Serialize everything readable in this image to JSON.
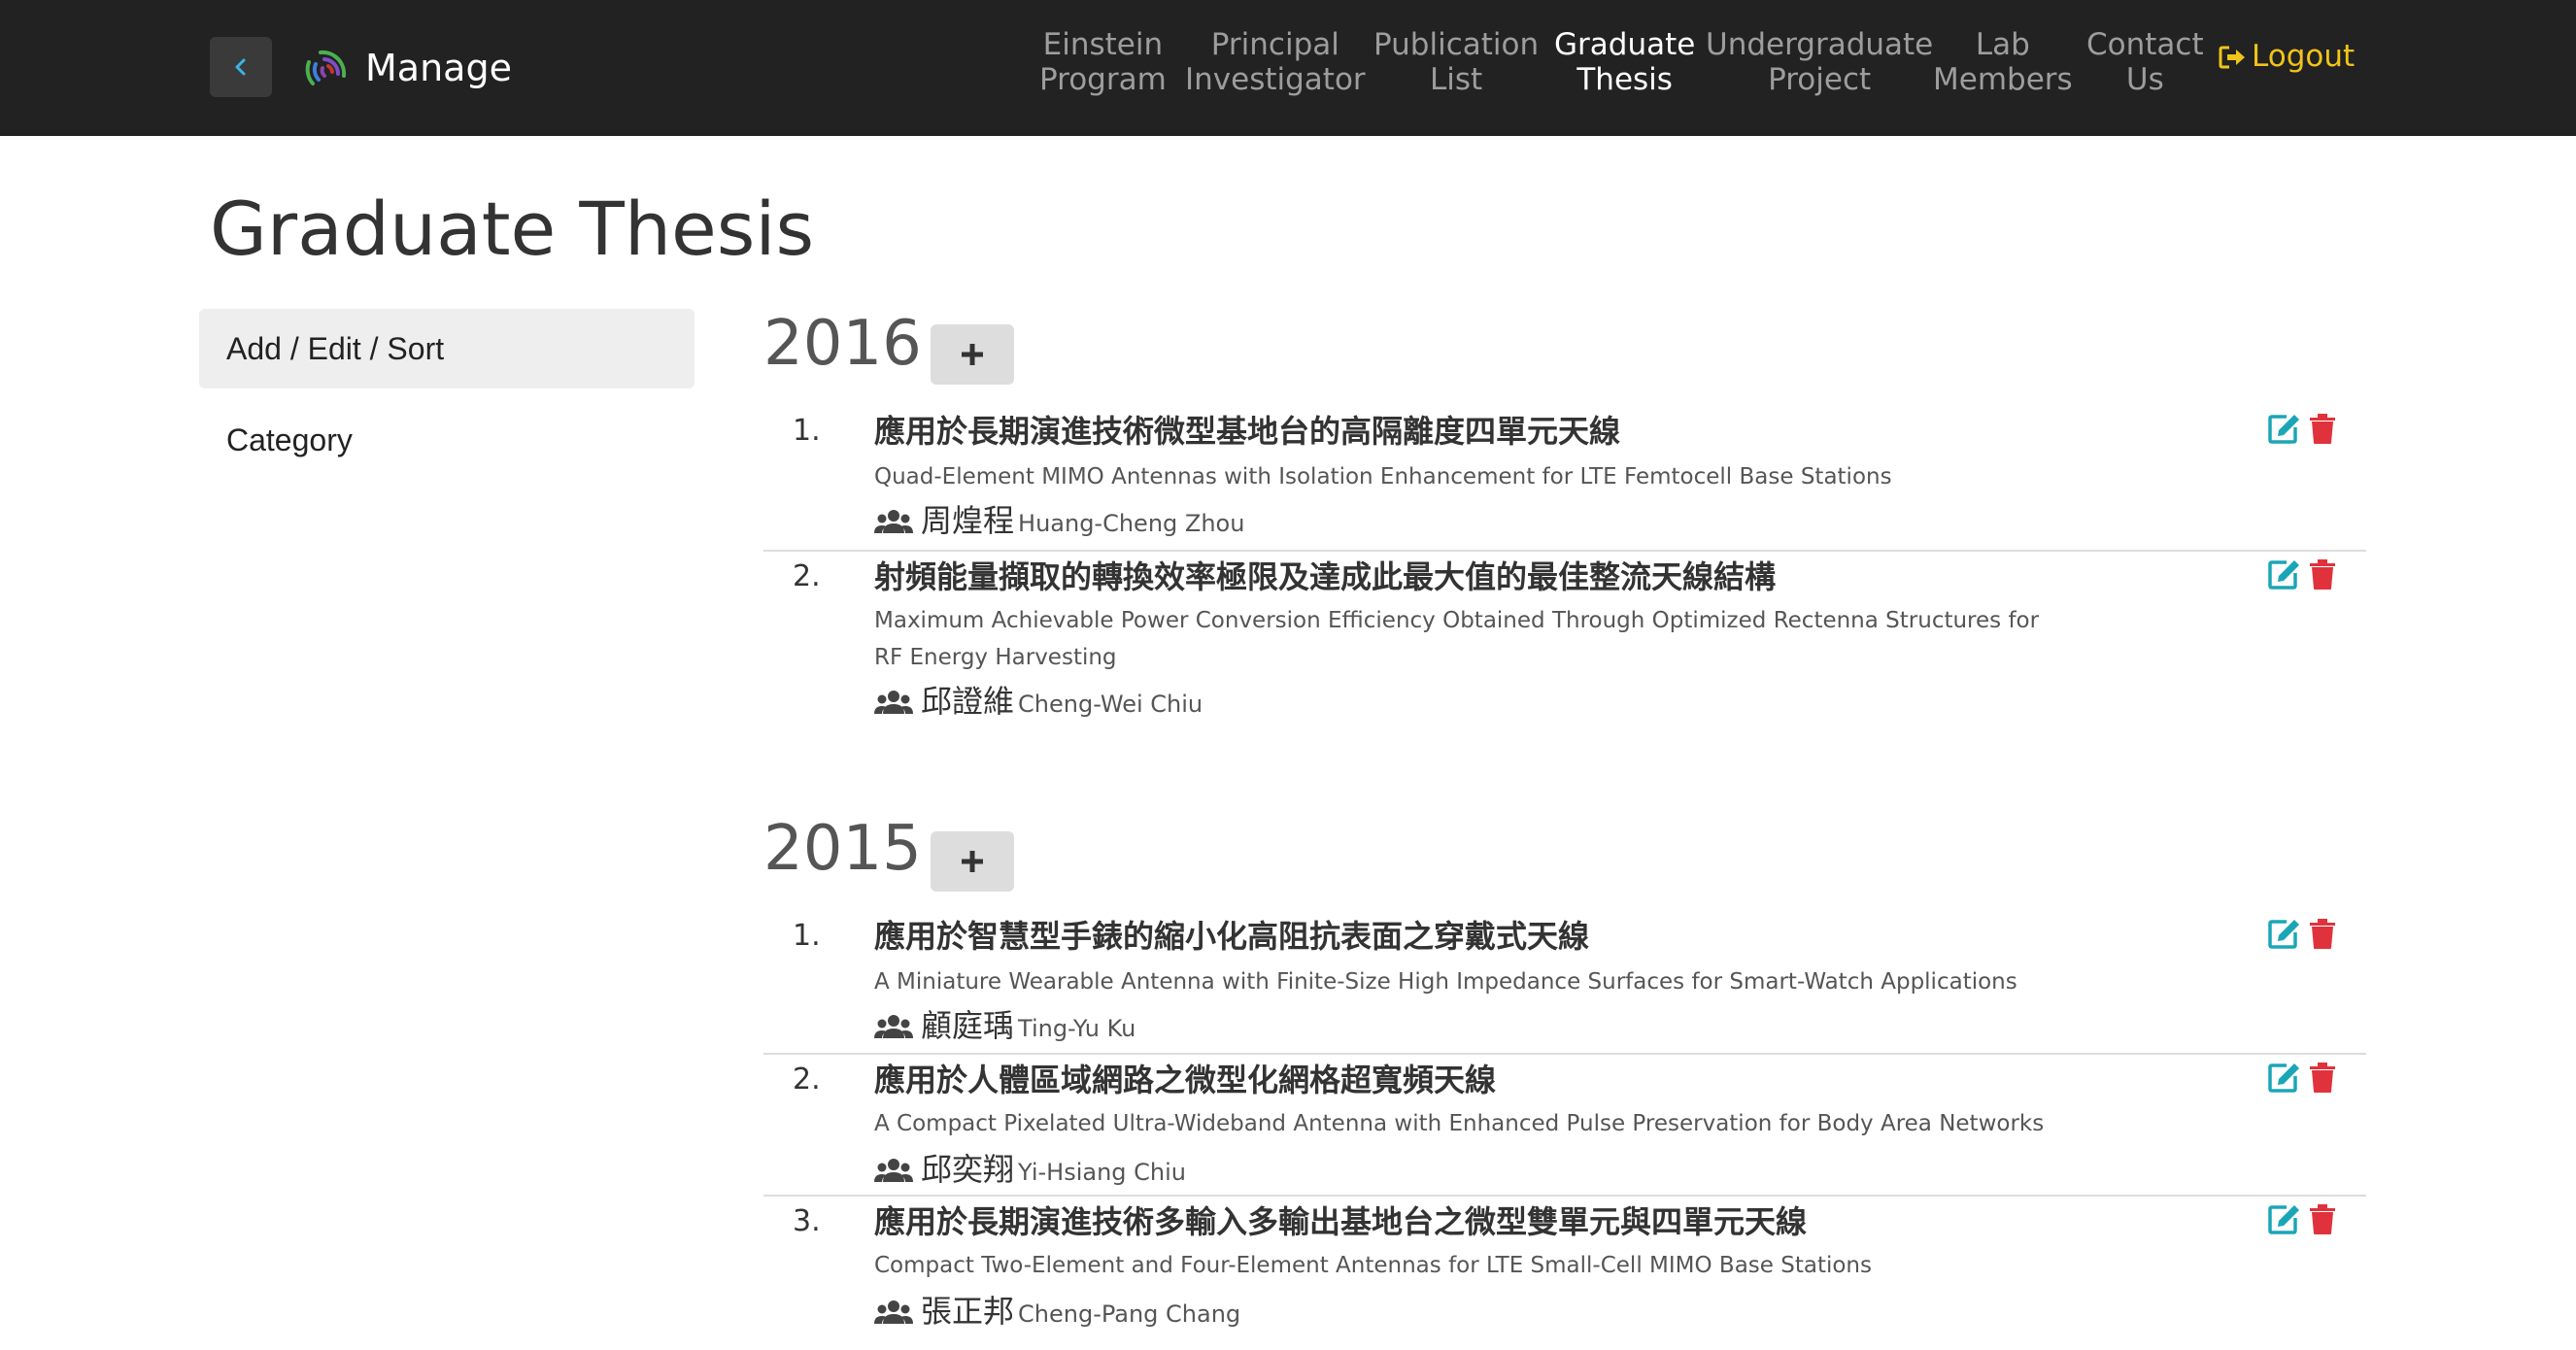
{
  "navbar": {
    "brand": "Manage",
    "items": [
      {
        "line1": "Einstein",
        "line2": "Program",
        "active": false
      },
      {
        "line1": "Principal",
        "line2": "Investigator",
        "active": false
      },
      {
        "line1": "Publication",
        "line2": "List",
        "active": false
      },
      {
        "line1": "Graduate",
        "line2": "Thesis",
        "active": true
      },
      {
        "line1": "Undergraduate",
        "line2": "Project",
        "active": false
      },
      {
        "line1": "Lab",
        "line2": "Members",
        "active": false
      },
      {
        "line1": "Contact",
        "line2": "Us",
        "active": false
      }
    ],
    "logout": "Logout",
    "colors": {
      "bg": "#222222",
      "logout": "#f0c419"
    }
  },
  "page": {
    "title": "Graduate Thesis"
  },
  "sidebar": {
    "items": [
      {
        "label": "Add / Edit / Sort",
        "active": true
      },
      {
        "label": "Category",
        "active": false
      }
    ]
  },
  "sections": [
    {
      "year": "2016",
      "entries": [
        {
          "num": "1.",
          "zh": "應用於長期演進技術微型基地台的高隔離度四單元天線",
          "en": "Quad-Element MIMO Antennas with Isolation Enhancement for LTE Femtocell Base Stations",
          "author_zh": "周煌程",
          "author_en": "Huang-Cheng Zhou"
        },
        {
          "num": "2.",
          "zh": "射頻能量擷取的轉換效率極限及達成此最大值的最佳整流天線結構",
          "en": "Maximum Achievable Power Conversion Efficiency Obtained Through Optimized Rectenna Structures for RF Energy Harvesting",
          "author_zh": "邱證維",
          "author_en": "Cheng-Wei Chiu"
        }
      ]
    },
    {
      "year": "2015",
      "entries": [
        {
          "num": "1.",
          "zh": "應用於智慧型手錶的縮小化高阻抗表面之穿戴式天線",
          "en": "A Miniature Wearable Antenna with Finite-Size High Impedance Surfaces for Smart-Watch Applications",
          "author_zh": "顧庭瑀",
          "author_en": "Ting-Yu Ku"
        },
        {
          "num": "2.",
          "zh": "應用於人體區域網路之微型化網格超寬頻天線",
          "en": "A Compact Pixelated Ultra-Wideband Antenna with Enhanced Pulse Preservation for Body Area Networks",
          "author_zh": "邱奕翔",
          "author_en": "Yi-Hsiang Chiu"
        },
        {
          "num": "3.",
          "zh": "應用於長期演進技術多輸入多輸出基地台之微型雙單元與四單元天線",
          "en": "Compact Two-Element and Four-Element Antennas for LTE Small-Cell MIMO Base Stations",
          "author_zh": "張正邦",
          "author_en": "Cheng-Pang Chang"
        }
      ]
    }
  ],
  "icons": {
    "edit": "edit-icon",
    "delete": "trash-icon",
    "author": "users-icon",
    "add": "plus-icon",
    "back": "chevron-left-icon",
    "logout": "sign-out-icon"
  },
  "colors": {
    "edit": "#1aa6b7",
    "delete": "#e0323c"
  }
}
